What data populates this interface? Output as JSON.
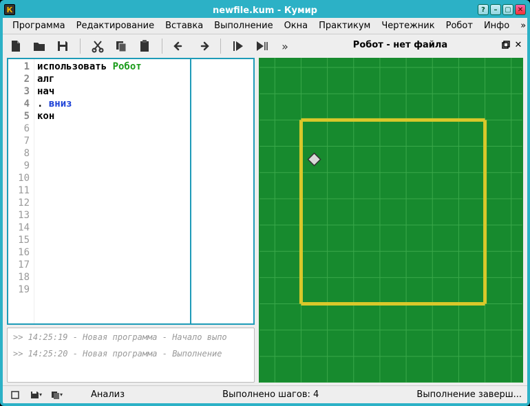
{
  "window": {
    "title": "newfile.kum - Кумир",
    "appicon_letter": "К"
  },
  "menu": [
    "Программа",
    "Редактирование",
    "Вставка",
    "Выполнение",
    "Окна",
    "Практикум",
    "Чертежник",
    "Робот",
    "Инфо",
    "»"
  ],
  "toolbar_icons": [
    "new-file",
    "open-file",
    "save-file",
    "cut",
    "copy",
    "paste",
    "undo",
    "redo",
    "run",
    "run-cursor",
    "more"
  ],
  "code": {
    "lines": [
      {
        "n": 1,
        "tokens": [
          {
            "t": "использовать ",
            "c": "kw"
          },
          {
            "t": "Робот",
            "c": "mod"
          }
        ]
      },
      {
        "n": 2,
        "tokens": [
          {
            "t": "алг",
            "c": "kw"
          }
        ]
      },
      {
        "n": 3,
        "tokens": [
          {
            "t": "нач",
            "c": "kw"
          }
        ]
      },
      {
        "n": 4,
        "tokens": [
          {
            "t": ". ",
            "c": "kw"
          },
          {
            "t": "вниз",
            "c": "cmd"
          }
        ]
      },
      {
        "n": 5,
        "tokens": [
          {
            "t": "кон",
            "c": "kw"
          }
        ]
      }
    ],
    "total_lines": 19
  },
  "log": [
    ">> 14:25:19 - Новая программа - Начало выпо",
    ">> 14:25:20 - Новая программа - Выполнение"
  ],
  "robot_panel": {
    "title": "Робот - нет файла"
  },
  "robot_field": {
    "cols": 7,
    "rows": 7,
    "robot_col": 0,
    "robot_row": 1
  },
  "status": {
    "analysis": "Анализ",
    "steps_label": "Выполнено шагов: 4",
    "run_state": "Выполнение заверш..."
  }
}
